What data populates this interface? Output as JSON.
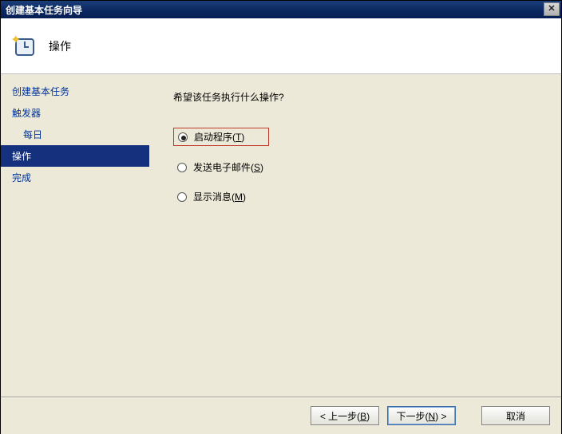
{
  "window": {
    "title": "创建基本任务向导",
    "close_symbol": "✕"
  },
  "header": {
    "title": "操作"
  },
  "sidebar": {
    "items": [
      {
        "label": "创建基本任务",
        "sub": false,
        "selected": false
      },
      {
        "label": "触发器",
        "sub": false,
        "selected": false
      },
      {
        "label": "每日",
        "sub": true,
        "selected": false
      },
      {
        "label": "操作",
        "sub": false,
        "selected": true
      },
      {
        "label": "完成",
        "sub": false,
        "selected": false
      }
    ]
  },
  "content": {
    "prompt": "希望该任务执行什么操作?",
    "options": [
      {
        "label_prefix": "启动程序(",
        "accel": "T",
        "label_suffix": ")",
        "checked": true,
        "highlight": true
      },
      {
        "label_prefix": "发送电子邮件(",
        "accel": "S",
        "label_suffix": ")",
        "checked": false,
        "highlight": false
      },
      {
        "label_prefix": "显示消息(",
        "accel": "M",
        "label_suffix": ")",
        "checked": false,
        "highlight": false
      }
    ]
  },
  "footer": {
    "back": {
      "prefix": "< 上一步(",
      "accel": "B",
      "suffix": ")"
    },
    "next": {
      "prefix": "下一步(",
      "accel": "N",
      "suffix": ") >"
    },
    "cancel": {
      "label": "取消"
    }
  }
}
